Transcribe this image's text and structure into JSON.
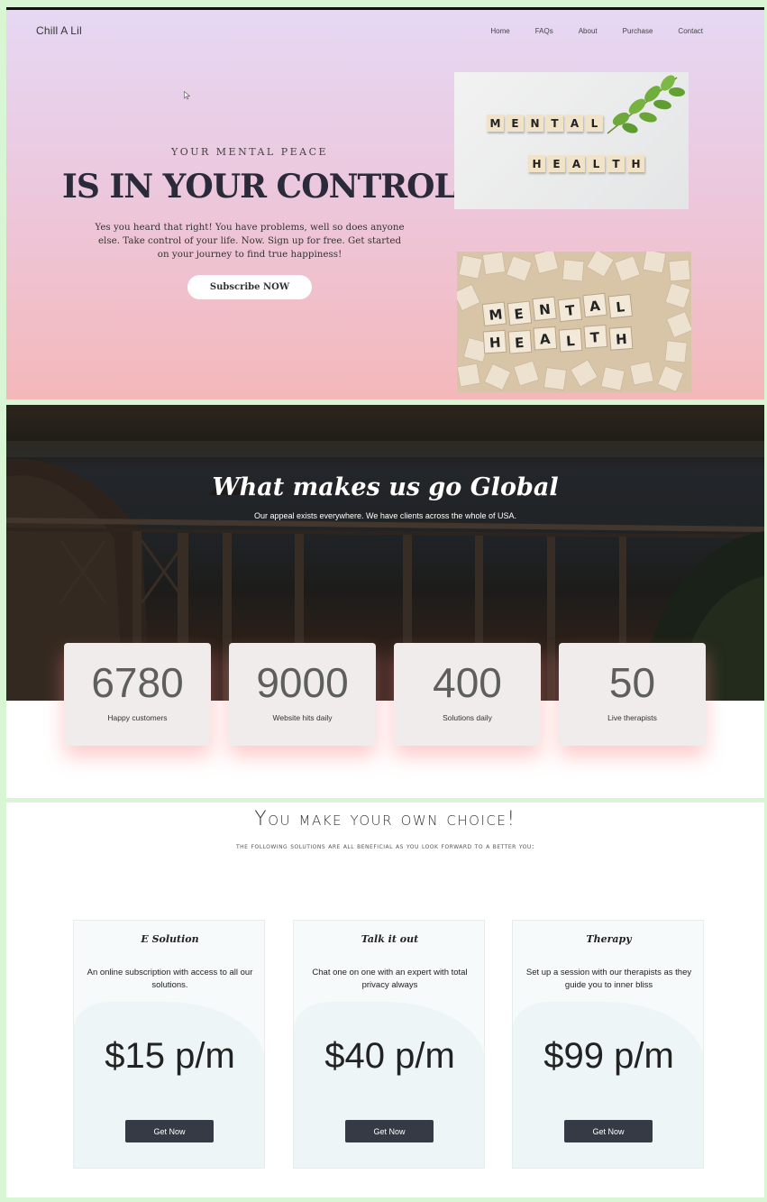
{
  "header": {
    "brand": "Chill A Lil",
    "nav": [
      "Home",
      "FAQs",
      "About",
      "Purchase",
      "Contact"
    ]
  },
  "hero": {
    "eyebrow": "YOUR MENTAL PEACE",
    "headline": "IS IN YOUR CONTROL",
    "lead": "Yes you heard that right! You have problems, well so does anyone else. Take control of your life. Now. Sign up for free. Get started on your journey to find true happiness!",
    "cta": "Subscribe NOW",
    "tiles_top_word1": "MENTAL",
    "tiles_top_word2": "HEALTH"
  },
  "global": {
    "title": "What makes us go Global",
    "subtitle": "Our appeal exists everywhere. We have clients across the whole of USA.",
    "stats": [
      {
        "value": "6780",
        "label": "Happy customers"
      },
      {
        "value": "9000",
        "label": "Website hits daily"
      },
      {
        "value": "400",
        "label": "Solutions daily"
      },
      {
        "value": "50",
        "label": "Live therapists"
      }
    ]
  },
  "pricing": {
    "title": "You make your own choice!",
    "subtitle": "the following solutions are all beneficial as you look forward to a better you:",
    "plans": [
      {
        "name": "E Solution",
        "desc": "An online subscription with access to all our solutions.",
        "price": "$15 p/m",
        "cta": "Get Now"
      },
      {
        "name": "Talk it out",
        "desc": "Chat one on one with an expert with total privacy always",
        "price": "$40 p/m",
        "cta": "Get Now"
      },
      {
        "name": "Therapy",
        "desc": "Set up a session with our therapists as they guide you to inner bliss",
        "price": "$99 p/m",
        "cta": "Get Now"
      }
    ]
  },
  "colors": {
    "hero_top": "#e6d8f4",
    "hero_bottom": "#f4b8ba",
    "button_dark": "#353a44",
    "frame": "#d8f5d4"
  }
}
